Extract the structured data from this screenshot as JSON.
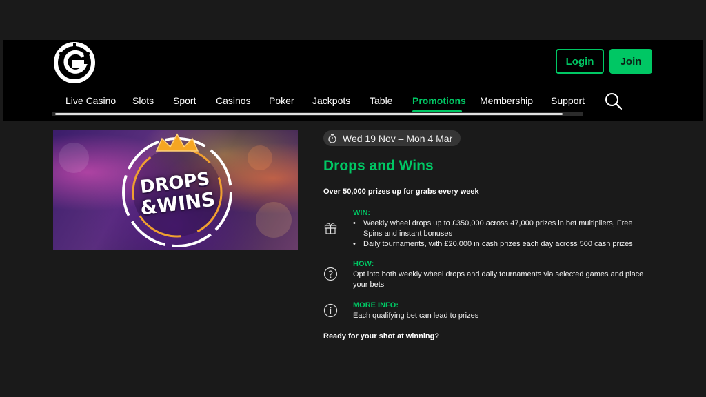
{
  "header": {
    "logo_icon": "g-logo-icon",
    "login_label": "Login",
    "join_label": "Join",
    "accent_color": "#00c764",
    "nav": [
      {
        "label": "Live Casino",
        "active": false
      },
      {
        "label": "Slots",
        "active": false
      },
      {
        "label": "Sport",
        "active": false
      },
      {
        "label": "Casinos",
        "active": false
      },
      {
        "label": "Poker",
        "active": false
      },
      {
        "label": "Jackpots",
        "active": false
      },
      {
        "label": "Table",
        "active": false
      },
      {
        "label": "Promotions",
        "active": true
      },
      {
        "label": "Membership",
        "active": false
      },
      {
        "label": "Support",
        "active": false
      }
    ],
    "search_icon": "search-icon"
  },
  "promo": {
    "image_text_line1": "DROPS",
    "image_text_line2": "&WINS",
    "date_icon": "stopwatch-icon",
    "date_range": "Wed 19 Nov – Mon 4 Mar",
    "title": "Drops and Wins",
    "subtitle": "Over 50,000 prizes up for grabs every week",
    "sections": {
      "win": {
        "icon": "gift-icon",
        "label": "WIN:",
        "bullets": [
          "Weekly wheel drops up to £350,000 across 47,000 prizes in bet multipliers, Free Spins and instant bonuses",
          "Daily tournaments, with £20,000 in cash prizes each day across 500 cash prizes"
        ]
      },
      "how": {
        "icon": "question-icon",
        "label": "HOW:",
        "text": "Opt into both weekly wheel drops and daily tournaments via selected games and place your bets"
      },
      "info": {
        "icon": "info-icon",
        "label": "MORE INFO:",
        "text": "Each qualifying bet can lead to prizes"
      }
    },
    "closing": "Ready for your shot at winning?"
  }
}
